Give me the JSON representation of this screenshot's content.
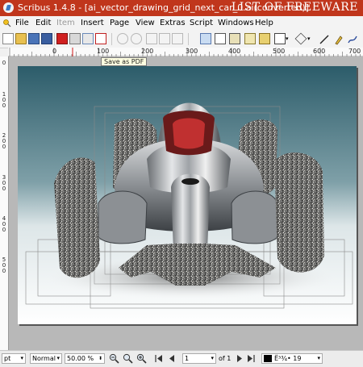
{
  "titlebar": {
    "title": "Scribus 1.4.8 - [ai_vector_drawing_grid_next_car_0.ai(converted)]",
    "watermark": "LIST OF FREEWARE"
  },
  "menu": {
    "items": [
      "File",
      "Edit",
      "Item",
      "Insert",
      "Page",
      "View",
      "Extras",
      "Script",
      "Windows",
      "Help"
    ]
  },
  "tooltip": {
    "text": "Save as PDF"
  },
  "ruler": {
    "horizontal": [
      "0",
      "100",
      "200",
      "300",
      "400",
      "500",
      "600",
      "700"
    ],
    "vertical": [
      "0",
      "1\n0\n0",
      "2\n0\n0",
      "3\n0\n0",
      "4\n0\n0",
      "5\n0\n0"
    ]
  },
  "status": {
    "unit": "pt",
    "mode": "Normal",
    "zoom": "50.00 %",
    "page_value": "1",
    "page_of": "of 1",
    "layer": "Ë³¾• 19"
  },
  "colors": {
    "titlebar": "#c0361c",
    "sky_top": "#2c5c6a",
    "accent_red": "#d01818"
  }
}
